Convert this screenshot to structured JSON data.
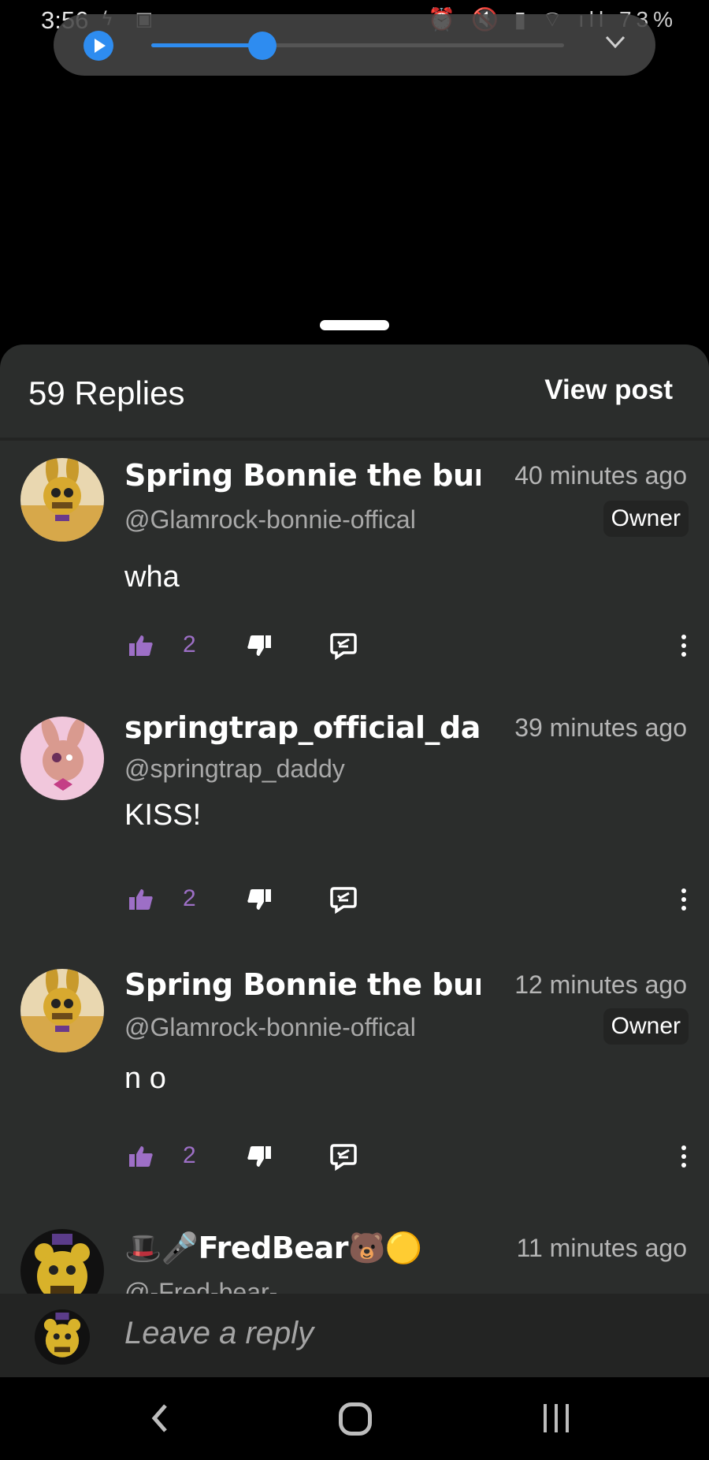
{
  "status_bar": {
    "time": "3:56",
    "battery": "73%"
  },
  "media": {
    "progress": 0.27
  },
  "sheet": {
    "replies_count": "59 Replies",
    "view_post": "View post"
  },
  "comments": [
    {
      "username": "Spring Bonnie the bunny",
      "handle": "@Glamrock-bonnie-offical",
      "time": "40 minutes ago",
      "badge": "Owner",
      "text": "wha",
      "likes": "2"
    },
    {
      "username": "springtrap_official_daddy",
      "handle": "@springtrap_daddy",
      "time": "39 minutes ago",
      "badge": "",
      "text": "KISS!",
      "likes": "2"
    },
    {
      "username": "Spring Bonnie the bunny",
      "handle": "@Glamrock-bonnie-offical",
      "time": "12 minutes ago",
      "badge": "Owner",
      "text": "n o",
      "likes": "2"
    },
    {
      "username": "🎩🎤FredBear🐻🟡",
      "handle": "@-Fred-bear-",
      "time": "11 minutes ago",
      "badge": "",
      "text": "",
      "likes": ""
    }
  ],
  "reply_input": {
    "placeholder": "Leave a reply"
  },
  "colors": {
    "accent": "#2e8cf0",
    "like": "#9d6fc6",
    "sheet_bg": "#2b2d2c"
  }
}
